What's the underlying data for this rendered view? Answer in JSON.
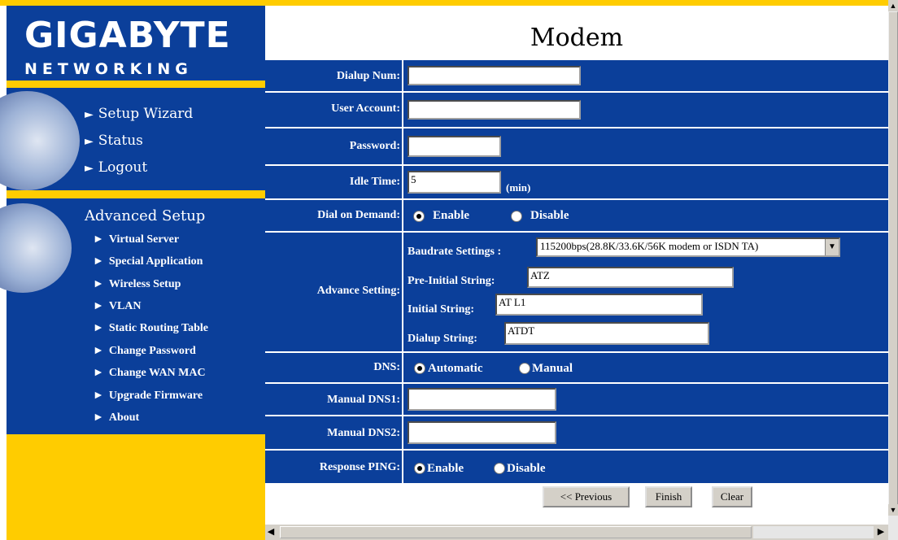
{
  "brand": {
    "logo": "GIGABYTE",
    "subtitle": "NETWORKING"
  },
  "nav": {
    "main": [
      {
        "label": "Setup Wizard"
      },
      {
        "label": "Status"
      },
      {
        "label": "Logout"
      }
    ],
    "advanced_title": "Advanced Setup",
    "advanced": [
      {
        "label": "Virtual Server"
      },
      {
        "label": "Special Application"
      },
      {
        "label": "Wireless Setup"
      },
      {
        "label": "VLAN"
      },
      {
        "label": "Static Routing Table"
      },
      {
        "label": "Change Password"
      },
      {
        "label": "Change WAN MAC"
      },
      {
        "label": "Upgrade Firmware"
      },
      {
        "label": "About"
      }
    ]
  },
  "page": {
    "title": "Modem"
  },
  "form": {
    "dialup_num": {
      "label": "Dialup Num:",
      "value": ""
    },
    "user_account": {
      "label": "User Account:",
      "value": ""
    },
    "password": {
      "label": "Password:",
      "value": ""
    },
    "idle_time": {
      "label": "Idle Time:",
      "value": "5",
      "unit": "(min)"
    },
    "dial_on_demand": {
      "label": "Dial on Demand:",
      "options": [
        "Enable",
        "Disable"
      ],
      "selected": "Enable"
    },
    "advance": {
      "label": "Advance Setting:",
      "baudrate_label": "Baudrate Settings :",
      "baudrate_value": "115200bps(28.8K/33.6K/56K modem or ISDN TA)",
      "pre_initial_label": "Pre-Initial String:",
      "pre_initial_value": "ATZ",
      "initial_label": "Initial String:",
      "initial_value": "AT L1",
      "dialup_label": "Dialup String:",
      "dialup_value": "ATDT"
    },
    "dns": {
      "label": "DNS:",
      "options": [
        "Automatic",
        "Manual"
      ],
      "selected": "Automatic"
    },
    "manual_dns1": {
      "label": "Manual DNS1:",
      "value": ""
    },
    "manual_dns2": {
      "label": "Manual DNS2:",
      "value": ""
    },
    "response_ping": {
      "label": "Response PING:",
      "options": [
        "Enable",
        "Disable"
      ],
      "selected": "Enable"
    }
  },
  "buttons": {
    "previous": "<< Previous",
    "finish": "Finish",
    "clear": "Clear"
  },
  "colors": {
    "panel_blue": "#0b3f9a",
    "accent_yellow": "#ffcc00"
  }
}
